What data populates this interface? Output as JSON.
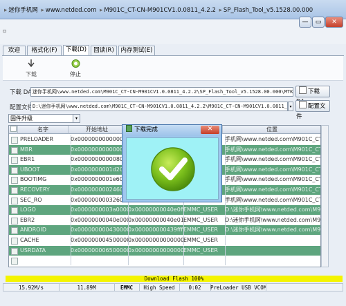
{
  "window": {
    "path": [
      "迷你手机网",
      "www.netded.com",
      "M901C_CT-CN-M901CV1.0.0811_4.2.2",
      "SP_Flash_Tool_v5.1528.00.000"
    ],
    "minimize_glyph": "—",
    "maximize_glyph": "▭",
    "close_glyph": "✕"
  },
  "tabs": [
    "欢迎(W)",
    "格式化(F)",
    "下载(D)",
    "回读(R)",
    "内存测试(E)"
  ],
  "active_tab": 2,
  "toolbar": {
    "download_label": "下载",
    "stop_label": "停止"
  },
  "download_agent": {
    "label": "下载 DA",
    "value": "迷你手机网\\www.netded.com\\M901C_CT-CN-M901CV1.0.0811_4.2.2\\SP_Flash_Tool_v5.1528.00.000\\MTK_AllInOne_DA.bin",
    "button": "下载 DA"
  },
  "scatter": {
    "label": "配置文件",
    "value": "D:\\迷你手机网\\www.netded.com\\M901C_CT-CN-M901CV1.0.0811_4.2.2\\M901C_CT-CN-M901CV1.0.0811_4.2.2\\MT659",
    "button": "配置文件"
  },
  "mode_select": {
    "value": "固件升级"
  },
  "table": {
    "columns": [
      "名字",
      "开始地址",
      "",
      "",
      "位置"
    ],
    "rows": [
      {
        "name": "PRELOADER",
        "begin": "0x0000000000000000",
        "end": "0x00",
        "region": "",
        "location": "手机网\\www.netded.com\\M901C_CT-C..."
      },
      {
        "name": "MBR",
        "begin": "0x0000000000000000",
        "end": "0x00",
        "region": "",
        "location": "手机网\\www.netded.com\\M901C_CT-C..."
      },
      {
        "name": "EBR1",
        "begin": "0x0000000000080000",
        "end": "0x00",
        "region": "",
        "location": "手机网\\www.netded.com\\M901C_CT-C..."
      },
      {
        "name": "UBOOT",
        "begin": "0x0000000001d20000",
        "end": "0x00",
        "region": "",
        "location": "手机网\\www.netded.com\\M901C_CT-C..."
      },
      {
        "name": "BOOTIMG",
        "begin": "0x0000000001e60000",
        "end": "0x00",
        "region": "",
        "location": "手机网\\www.netded.com\\M901C_CT-C..."
      },
      {
        "name": "RECOVERY",
        "begin": "0x0000000002460000",
        "end": "0x00",
        "region": "",
        "location": "手机网\\www.netded.com\\M901C_CT-C..."
      },
      {
        "name": "SEC_RO",
        "begin": "0x0000000003260000",
        "end": "0x00",
        "region": "",
        "location": "手机网\\www.netded.com\\M901C_CT-C..."
      },
      {
        "name": "LOGO",
        "begin": "0x0000000003a00000",
        "end": "0x00000000040e0ff",
        "region": "EMMC_USER",
        "location": "D:\\迷你手机网\\www.netded.com\\M901C_CT-C..."
      },
      {
        "name": "EBR2",
        "begin": "0x00000000040e0000",
        "end": "0x00000000040e01ff",
        "region": "EMMC_USER",
        "location": "D:\\迷你手机网\\www.netded.com\\M901C_CT-C..."
      },
      {
        "name": "ANDROID",
        "begin": "0x0000000004300000",
        "end": "0x000000000439ffff",
        "region": "EMMC_USER",
        "location": "D:\\迷你手机网\\www.netded.com\\M901C_CT-C..."
      },
      {
        "name": "CACHE",
        "begin": "0x0000000045000000",
        "end": "0x0000000000000000",
        "region": "EMMC_USER",
        "location": ""
      },
      {
        "name": "USRDATA",
        "begin": "0x0000000065000000",
        "end": "0x0000000000000000",
        "region": "EMMC_USER",
        "location": ""
      },
      {
        "name": "",
        "begin": "",
        "end": "",
        "region": "",
        "location": ""
      }
    ]
  },
  "dialog": {
    "title": "下载完成",
    "close_glyph": "✕"
  },
  "progress": {
    "text": "Download Flash 100%",
    "percent": 100
  },
  "status": [
    "15.92M/s",
    "11.89M",
    "EMMC",
    "High Speed",
    "0:02",
    "PreLoader USB VCOM"
  ],
  "colors": {
    "row_green": "#5ea57e",
    "progress_yellow": "#f4f400",
    "dialog_body": "#9ff2f6"
  }
}
